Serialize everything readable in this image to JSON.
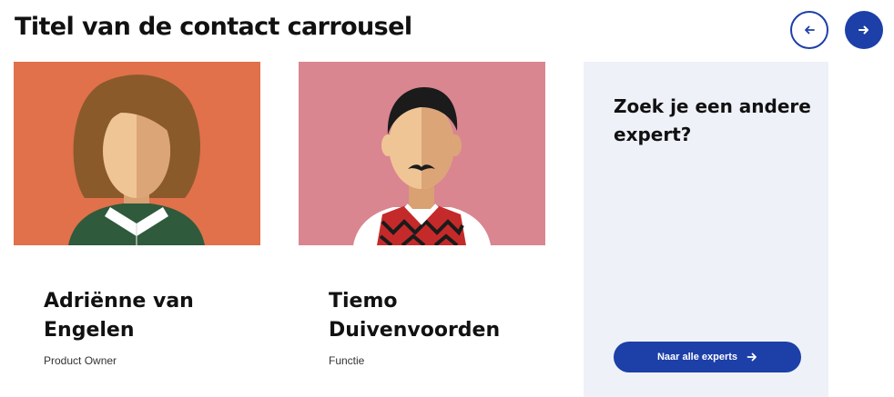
{
  "header": {
    "title": "Titel van de contact carrousel",
    "prev_icon": "arrow-left-icon",
    "next_icon": "arrow-right-icon"
  },
  "cards": [
    {
      "name": "Adriënne van Engelen",
      "role": "Product Owner",
      "portrait_bg": "#e0714a"
    },
    {
      "name": "Tiemo Duivenvoorden",
      "role": "Functie",
      "portrait_bg": "#d98690"
    }
  ],
  "cta": {
    "title": "Zoek je een andere expert?",
    "button_label": "Naar alle experts",
    "button_icon": "arrow-right-icon"
  },
  "colors": {
    "accent": "#1d3fa8",
    "cta_bg": "#eef1f8"
  }
}
